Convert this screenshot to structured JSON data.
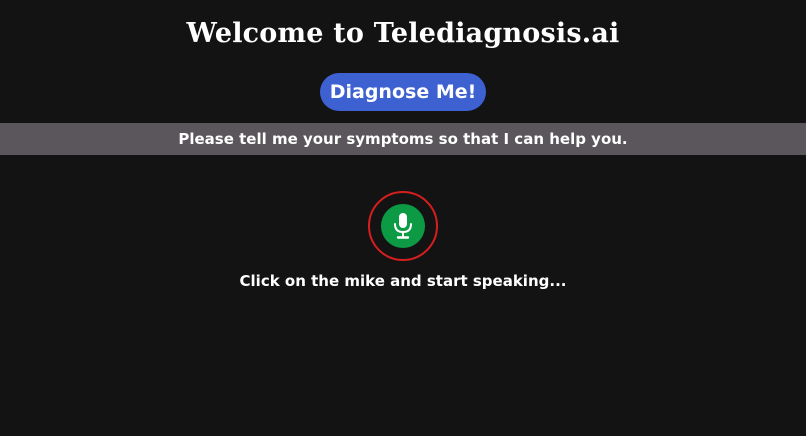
{
  "header": {
    "title": "Welcome to Telediagnosis.ai"
  },
  "actions": {
    "diagnose_label": "Diagnose Me!"
  },
  "prompt": {
    "text": "Please tell me your symptoms so that I can help you."
  },
  "voice": {
    "mic_icon": "microphone-icon",
    "hint": "Click on the mike and start speaking..."
  },
  "colors": {
    "background": "#141314",
    "button": "#3e61d2",
    "prompt_bar": "#5a565b",
    "mic_fill": "#0c9a45",
    "mic_ring": "#d61e1e"
  }
}
